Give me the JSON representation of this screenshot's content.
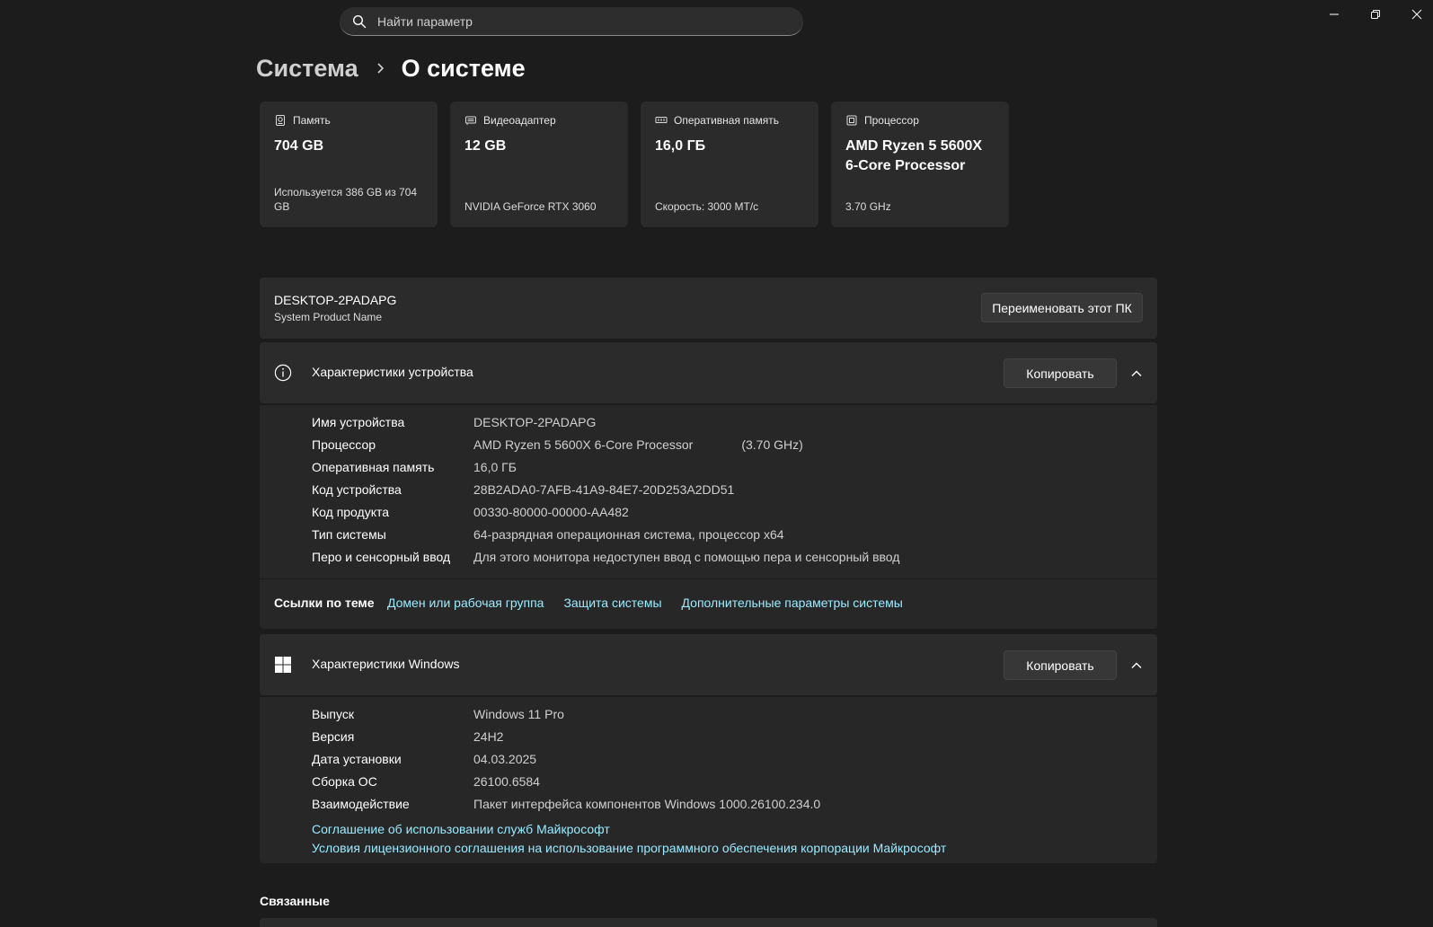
{
  "search": {
    "placeholder": "Найти параметр"
  },
  "breadcrumb": {
    "parent": "Система",
    "current": "О системе"
  },
  "tiles": [
    {
      "icon": "storage-icon",
      "label": "Память",
      "value": "704 GB",
      "sub": "Используется 386 GB из 704 GB"
    },
    {
      "icon": "display-adapter-icon",
      "label": "Видеоадаптер",
      "value": "12 GB",
      "sub": "NVIDIA GeForce RTX 3060"
    },
    {
      "icon": "ram-icon",
      "label": "Оперативная память",
      "value": "16,0 ГБ",
      "sub": "Скорость: 3000 MT/с"
    },
    {
      "icon": "processor-icon",
      "label": "Процессор",
      "value": "AMD Ryzen 5 5600X 6-Core Processor",
      "sub": "3.70 GHz"
    }
  ],
  "pc": {
    "name": "DESKTOP-2PADAPG",
    "model": "System Product Name",
    "rename_label": "Переименовать этот ПК"
  },
  "device_specs": {
    "title": "Характеристики устройства",
    "copy_label": "Копировать",
    "rows": [
      {
        "label": "Имя устройства",
        "value": "DESKTOP-2PADAPG",
        "extra": ""
      },
      {
        "label": "Процессор",
        "value": "AMD Ryzen 5 5600X 6-Core Processor",
        "extra": "(3.70 GHz)"
      },
      {
        "label": "Оперативная память",
        "value": "16,0 ГБ",
        "extra": ""
      },
      {
        "label": "Код устройства",
        "value": "28B2ADA0-7AFB-41A9-84E7-20D253A2DD51",
        "extra": ""
      },
      {
        "label": "Код продукта",
        "value": "00330-80000-00000-AA482",
        "extra": ""
      },
      {
        "label": "Тип системы",
        "value": "64-разрядная операционная система, процессор x64",
        "extra": ""
      },
      {
        "label": "Перо и сенсорный ввод",
        "value": "Для этого монитора недоступен ввод с помощью пера и сенсорный ввод",
        "extra": ""
      }
    ]
  },
  "related_links": {
    "title": "Ссылки по теме",
    "items": [
      "Домен или рабочая группа",
      "Защита системы",
      "Дополнительные параметры системы"
    ]
  },
  "windows_specs": {
    "title": "Характеристики Windows",
    "copy_label": "Копировать",
    "rows": [
      {
        "label": "Выпуск",
        "value": "Windows 11 Pro"
      },
      {
        "label": "Версия",
        "value": "24H2"
      },
      {
        "label": "Дата установки",
        "value": "04.03.2025"
      },
      {
        "label": "Сборка ОС",
        "value": "26100.6584"
      },
      {
        "label": "Взаимодействие",
        "value": "Пакет интерфейса компонентов Windows 1000.26100.234.0"
      }
    ],
    "links": [
      "Соглашение об использовании служб Майкрософт",
      "Условия лицензионного соглашения на использование программного обеспечения корпорации Майкрософт"
    ]
  },
  "related": {
    "title": "Связанные"
  },
  "colors": {
    "background": "#1c1c1c",
    "card": "#2b2b2b",
    "link": "#99ebff"
  }
}
